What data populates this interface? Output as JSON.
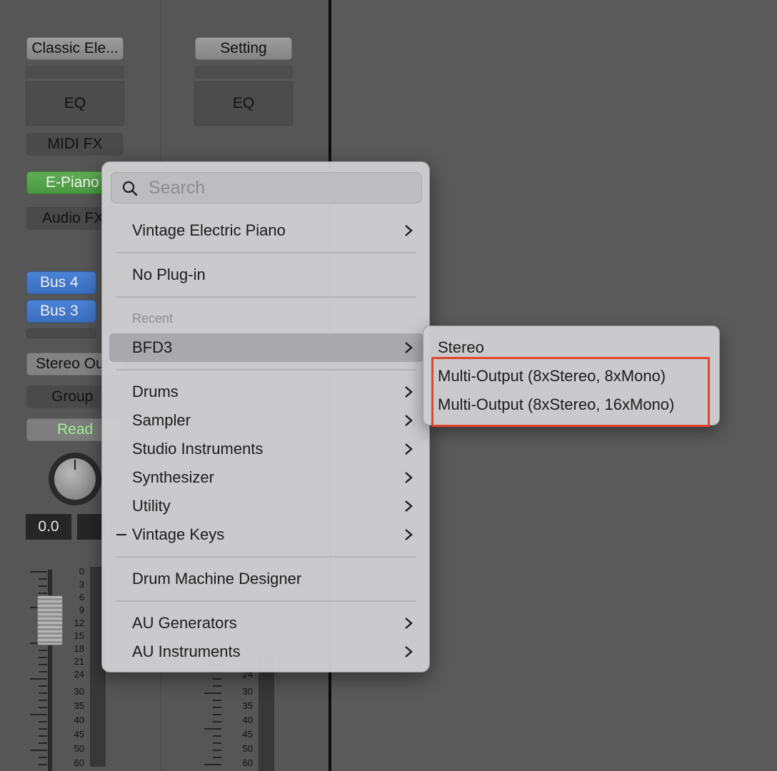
{
  "mixer": {
    "strip1": {
      "setting_label": "Classic Ele...",
      "eq_label": "EQ",
      "midi_fx_label": "MIDI FX",
      "instrument_label": "E-Piano",
      "audio_fx_label": "Audio FX",
      "sends": [
        "Bus 4",
        "Bus 3"
      ],
      "output_label": "Stereo Out",
      "group_label": "Group",
      "automation_label": "Read",
      "pan_value": "0.0"
    },
    "strip2": {
      "setting_label": "Setting",
      "eq_label": "EQ"
    },
    "meter_scale": [
      "0",
      "3",
      "6",
      "9",
      "12",
      "15",
      "18",
      "21",
      "24",
      "30",
      "35",
      "40",
      "45",
      "50",
      "60"
    ]
  },
  "menu": {
    "search_placeholder": "Search",
    "current_plugin": "Vintage Electric Piano",
    "no_plugin": "No Plug-in",
    "recent_header": "Recent",
    "recent_item": "BFD3",
    "categories": [
      "Drums",
      "Sampler",
      "Studio Instruments",
      "Synthesizer",
      "Utility",
      "Vintage Keys"
    ],
    "drum_machine": "Drum Machine Designer",
    "au_items": [
      "AU Generators",
      "AU Instruments"
    ]
  },
  "submenu": {
    "items": [
      "Stereo",
      "Multi-Output (8xStereo, 8xMono)",
      "Multi-Output (8xStereo, 16xMono)"
    ]
  },
  "colors": {
    "highlight_box": "#e2452c",
    "instrument_slot": "#5fae55",
    "send_slot": "#4b82d4",
    "automation_text": "#9df58d"
  }
}
